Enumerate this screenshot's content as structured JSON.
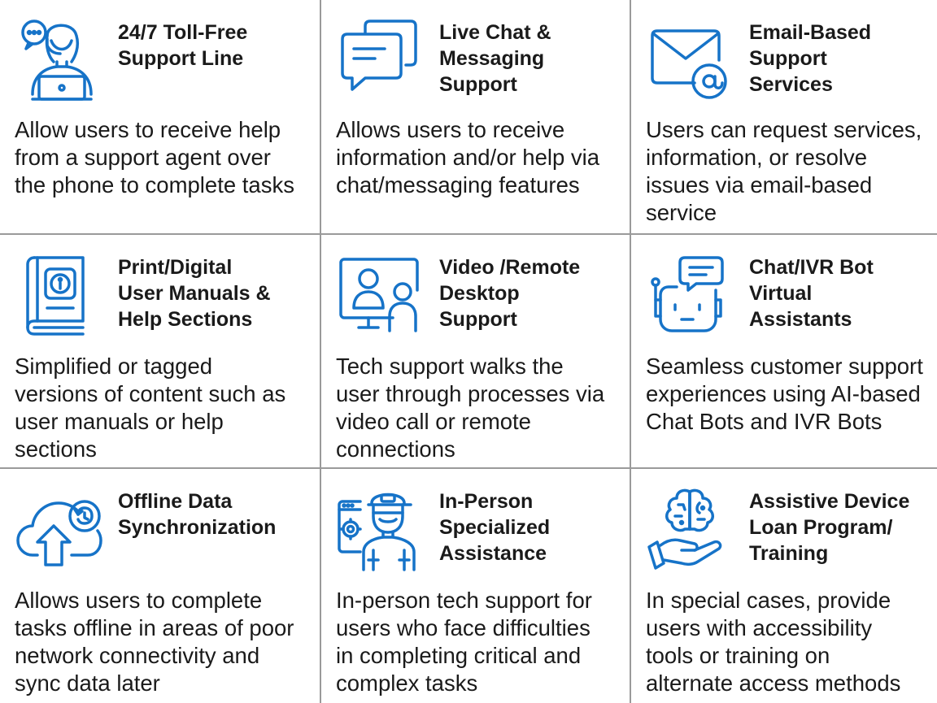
{
  "cards": [
    {
      "icon": "headset-agent-icon",
      "title_lines": [
        "24/7 Toll-Free",
        "Support Line"
      ],
      "description_lines": [
        "Allow users to receive help",
        "from a support agent over",
        "the phone to complete tasks"
      ]
    },
    {
      "icon": "chat-bubbles-icon",
      "title_lines": [
        "Live Chat &",
        "Messaging",
        "Support"
      ],
      "description_lines": [
        "Allows users to receive",
        "information and/or help via",
        "chat/messaging features"
      ]
    },
    {
      "icon": "email-at-icon",
      "title_lines": [
        "Email-Based",
        "Support",
        "Services"
      ],
      "description_lines": [
        "Users can request services,",
        "information, or resolve",
        "issues via email-based",
        "service"
      ]
    },
    {
      "icon": "manual-book-icon",
      "title_lines": [
        "Print/Digital",
        "User Manuals &",
        "Help Sections"
      ],
      "description_lines": [
        "Simplified or tagged",
        "versions of content such as",
        "user manuals or help",
        "sections"
      ]
    },
    {
      "icon": "remote-desktop-video-icon",
      "title_lines": [
        "Video /Remote",
        "Desktop",
        "Support"
      ],
      "description_lines": [
        "Tech support walks the",
        "user through processes via",
        "video call or remote",
        "connections"
      ]
    },
    {
      "icon": "chat-bot-icon",
      "title_lines": [
        "Chat/IVR Bot",
        "Virtual",
        "Assistants"
      ],
      "description_lines": [
        "Seamless customer support",
        "experiences using AI-based",
        "Chat Bots and IVR Bots"
      ]
    },
    {
      "icon": "cloud-sync-icon",
      "title_lines": [
        "Offline Data",
        "Synchronization"
      ],
      "description_lines": [
        "Allows users to complete",
        "tasks offline in areas of poor",
        "network connectivity and",
        "sync data later"
      ]
    },
    {
      "icon": "technician-icon",
      "title_lines": [
        "In-Person",
        "Specialized",
        "Assistance"
      ],
      "description_lines": [
        "In-person tech support for",
        "users who face difficulties",
        "in completing critical and",
        "complex tasks"
      ]
    },
    {
      "icon": "brain-hand-icon",
      "title_lines": [
        "Assistive Device",
        "Loan Program/",
        "Training"
      ],
      "description_lines": [
        "In special cases, provide",
        "users with accessibility",
        "tools or training on",
        "alternate access methods"
      ]
    }
  ],
  "colors": {
    "icon_blue": "#1673c8",
    "text": "#1a1a1a",
    "border": "#9a9a9a"
  }
}
